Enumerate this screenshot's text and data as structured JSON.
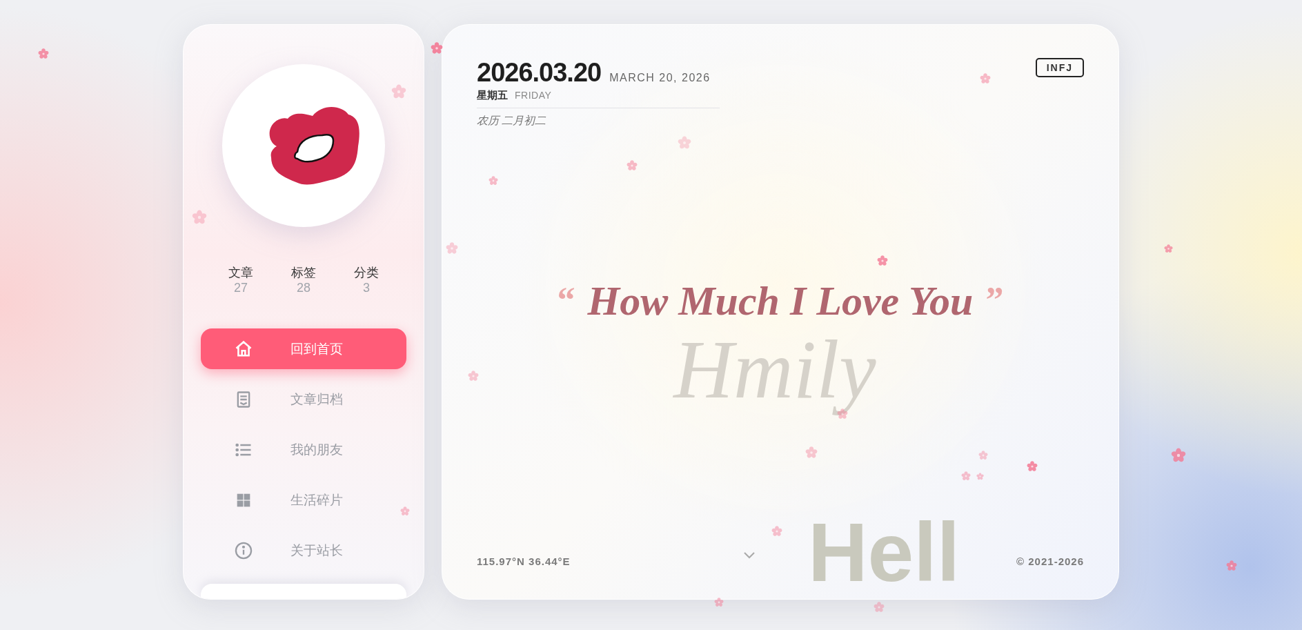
{
  "profile": {
    "stats": [
      {
        "label": "文章",
        "value": "27"
      },
      {
        "label": "标签",
        "value": "28"
      },
      {
        "label": "分类",
        "value": "3"
      }
    ]
  },
  "nav": [
    {
      "kind": "home",
      "label": "回到首页",
      "selected": true
    },
    {
      "kind": "archive",
      "label": "文章归档",
      "selected": false
    },
    {
      "kind": "list",
      "label": "我的朋友",
      "selected": false
    },
    {
      "kind": "grid",
      "label": "生活碎片",
      "selected": false
    },
    {
      "kind": "info",
      "label": "关于站长",
      "selected": false
    }
  ],
  "date": {
    "numeric": "2026.03.20",
    "long": "MARCH 20, 2026",
    "weekday_cn": "星期五",
    "weekday_en": "FRIDAY",
    "lunar": "农历 二月初二"
  },
  "badge": "INFJ",
  "quote": {
    "open": "“",
    "text": "How Much I Love You",
    "close": "”"
  },
  "watermarks": [
    "Hmily",
    "Hell"
  ],
  "footer": {
    "coordinates": "115.97°N 36.44°E",
    "copyright": "© 2021-2026"
  }
}
